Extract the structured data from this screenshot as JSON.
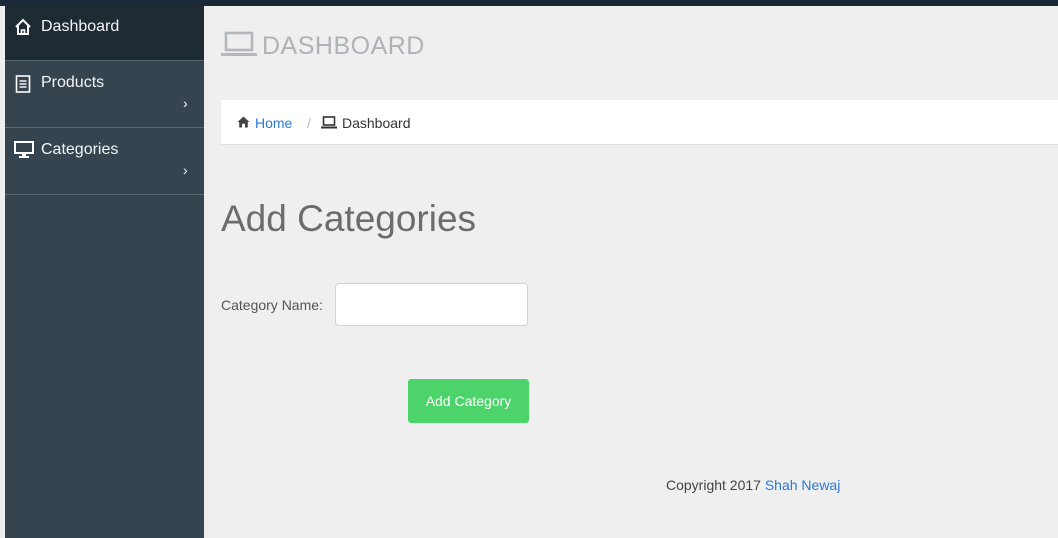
{
  "sidebar": {
    "items": [
      {
        "label": "Dashboard",
        "icon": "home-icon",
        "active": true
      },
      {
        "label": "Products",
        "icon": "document-icon",
        "chevron": "›"
      },
      {
        "label": "Categories",
        "icon": "monitor-icon",
        "chevron": "›"
      }
    ]
  },
  "header": {
    "title": "DASHBOARD",
    "icon": "laptop-icon"
  },
  "breadcrumb": {
    "home_label": "Home",
    "separator": "/",
    "current_label": "Dashboard"
  },
  "main": {
    "title": "Add Categories",
    "category_label": "Category Name:",
    "category_value": "",
    "add_button_label": "Add Category"
  },
  "footer": {
    "copyright_text": "Copyright 2017 ",
    "author_link": "Shah Newaj"
  },
  "colors": {
    "sidebar_bg": "#36444f",
    "active_bg": "#1f2b33",
    "accent_blue": "#2b7ad6",
    "button_green": "#4cd46b"
  }
}
